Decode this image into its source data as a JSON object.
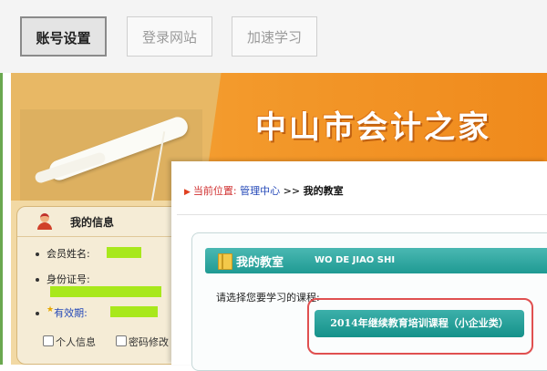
{
  "toolbar": {
    "buttons": [
      {
        "label": "账号设置",
        "active": true
      },
      {
        "label": "登录网站",
        "active": false
      },
      {
        "label": "加速学习",
        "active": false
      }
    ]
  },
  "banner": {
    "title": "中山市会计之家"
  },
  "sidebar": {
    "title": "我的信息",
    "member_name_label": "会员姓名:",
    "id_number_label": "身份证号:",
    "expiry_label": "有效期:",
    "links": [
      {
        "label": "个人信息"
      },
      {
        "label": "密码修改"
      }
    ]
  },
  "breadcrumb": {
    "prefix": "当前位置:",
    "link": "管理中心",
    "separator": ">>",
    "current": "我的教室"
  },
  "classroom": {
    "title": "我的教室",
    "subtitle": "WO DE JIAO SHI",
    "prompt": "请选择您要学习的课程:",
    "course_button": "2014年继续教育培训课程（小企业类）"
  },
  "colors": {
    "accent_teal": "#1f9a93",
    "banner_orange": "#f08a1c",
    "highlight_green": "#a8e81c",
    "annotation_red": "#e05050"
  }
}
